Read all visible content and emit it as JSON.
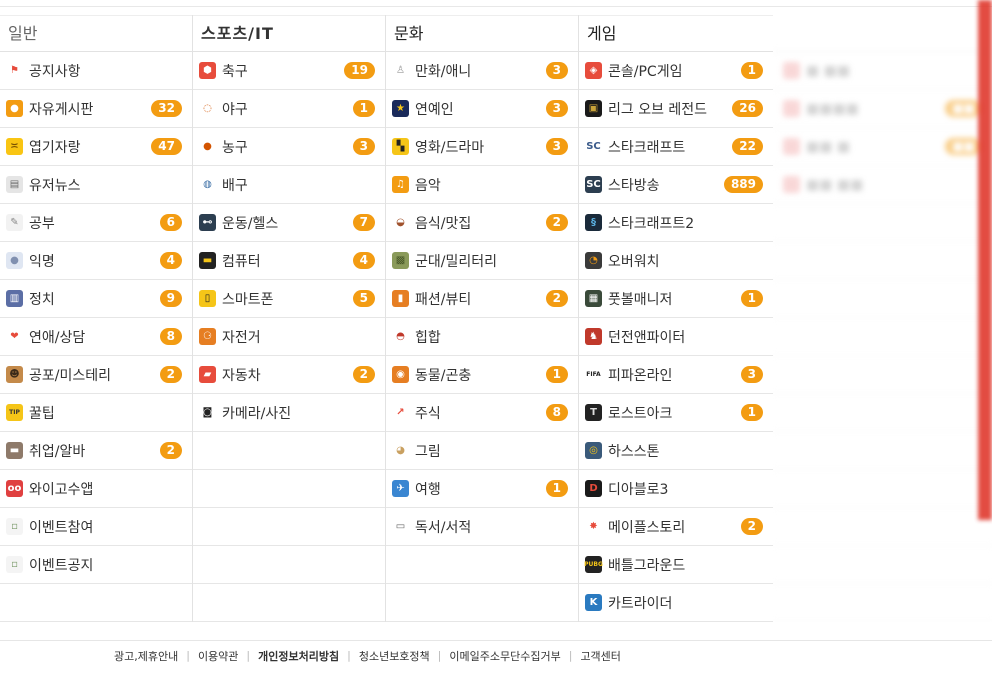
{
  "columns": [
    {
      "title": "일반",
      "items": [
        {
          "icon": "flag-icon",
          "glyph": "⚑",
          "color": "#e74c3c",
          "bg": "transparent",
          "label": "공지사항",
          "count": ""
        },
        {
          "icon": "chat-bubble-icon",
          "glyph": "●",
          "color": "#ffffff",
          "bg": "#f39c12",
          "label": "자유게시판",
          "count": "32"
        },
        {
          "icon": "laughing-face-icon",
          "glyph": "≍",
          "color": "#7a5200",
          "bg": "#f9c513",
          "label": "엽기자랑",
          "count": "47"
        },
        {
          "icon": "newspaper-icon",
          "glyph": "▤",
          "color": "#666",
          "bg": "#e5e5e5",
          "label": "유저뉴스",
          "count": ""
        },
        {
          "icon": "pencil-note-icon",
          "glyph": "✎",
          "color": "#888",
          "bg": "#f2f2f2",
          "label": "공부",
          "count": "6"
        },
        {
          "icon": "user-silhouette-icon",
          "glyph": "●",
          "color": "#8090b0",
          "bg": "#dfe6f2",
          "label": "익명",
          "count": "4"
        },
        {
          "icon": "government-building-icon",
          "glyph": "▥",
          "color": "#fff",
          "bg": "#5b6ea5",
          "label": "정치",
          "count": "9"
        },
        {
          "icon": "heart-icon",
          "glyph": "❤",
          "color": "#e74c3c",
          "bg": "transparent",
          "label": "연애/상담",
          "count": "8"
        },
        {
          "icon": "horror-face-icon",
          "glyph": "☻",
          "color": "#3a2a1a",
          "bg": "#c48a4a",
          "label": "공포/미스테리",
          "count": "2"
        },
        {
          "icon": "tip-badge-icon",
          "glyph": "TIP",
          "color": "#333",
          "bg": "#f5c518",
          "label": "꿀팁",
          "count": ""
        },
        {
          "icon": "briefcase-icon",
          "glyph": "▬",
          "color": "#fff",
          "bg": "#8e7a6a",
          "label": "취업/알바",
          "count": "2"
        },
        {
          "icon": "monster-icon",
          "glyph": "oo",
          "color": "#fff",
          "bg": "#e04040",
          "label": "와이고수앱",
          "count": ""
        },
        {
          "icon": "broken-image-icon",
          "glyph": "▫",
          "color": "#7a9a6a",
          "bg": "#f4f4f4",
          "label": "이벤트참여",
          "count": ""
        },
        {
          "icon": "broken-image-icon",
          "glyph": "▫",
          "color": "#7a9a6a",
          "bg": "#f4f4f4",
          "label": "이벤트공지",
          "count": ""
        },
        {
          "icon": "",
          "glyph": "",
          "color": "",
          "bg": "transparent",
          "label": "",
          "count": ""
        }
      ]
    },
    {
      "title": "스포츠/IT",
      "items": [
        {
          "icon": "soccer-ball-icon",
          "glyph": "⬢",
          "color": "#fff",
          "bg": "#e74c3c",
          "label": "축구",
          "count": "19"
        },
        {
          "icon": "baseball-icon",
          "glyph": "◌",
          "color": "#d35400",
          "bg": "#ffffff",
          "label": "야구",
          "count": "1"
        },
        {
          "icon": "basketball-icon",
          "glyph": "●",
          "color": "#d35400",
          "bg": "transparent",
          "label": "농구",
          "count": "3"
        },
        {
          "icon": "volleyball-icon",
          "glyph": "◍",
          "color": "#3a6ea5",
          "bg": "transparent",
          "label": "배구",
          "count": ""
        },
        {
          "icon": "dumbbell-icon",
          "glyph": "⊷",
          "color": "#fff",
          "bg": "#2c3e50",
          "label": "운동/헬스",
          "count": "7"
        },
        {
          "icon": "monitor-icon",
          "glyph": "▬",
          "color": "#f5c518",
          "bg": "#222",
          "label": "컴퓨터",
          "count": "4"
        },
        {
          "icon": "smartphone-icon",
          "glyph": "▯",
          "color": "#222",
          "bg": "#f5c518",
          "label": "스마트폰",
          "count": "5"
        },
        {
          "icon": "bicycle-icon",
          "glyph": "⚆",
          "color": "#fff",
          "bg": "#e67e22",
          "label": "자전거",
          "count": ""
        },
        {
          "icon": "car-icon",
          "glyph": "▰",
          "color": "#fff",
          "bg": "#e74c3c",
          "label": "자동차",
          "count": "2"
        },
        {
          "icon": "camera-icon",
          "glyph": "◙",
          "color": "#222",
          "bg": "transparent",
          "label": "카메라/사진",
          "count": ""
        },
        {
          "icon": "",
          "glyph": "",
          "color": "",
          "bg": "transparent",
          "label": "",
          "count": ""
        },
        {
          "icon": "",
          "glyph": "",
          "color": "",
          "bg": "transparent",
          "label": "",
          "count": ""
        },
        {
          "icon": "",
          "glyph": "",
          "color": "",
          "bg": "transparent",
          "label": "",
          "count": ""
        },
        {
          "icon": "",
          "glyph": "",
          "color": "",
          "bg": "transparent",
          "label": "",
          "count": ""
        },
        {
          "icon": "",
          "glyph": "",
          "color": "",
          "bg": "transparent",
          "label": "",
          "count": ""
        }
      ]
    },
    {
      "title": "문화",
      "items": [
        {
          "icon": "comic-character-icon",
          "glyph": "♙",
          "color": "#999",
          "bg": "transparent",
          "label": "만화/애니",
          "count": "3"
        },
        {
          "icon": "star-icon",
          "glyph": "★",
          "color": "#f5c518",
          "bg": "#1a2a5a",
          "label": "연예인",
          "count": "3"
        },
        {
          "icon": "clapperboard-icon",
          "glyph": "▚",
          "color": "#222",
          "bg": "#f5c518",
          "label": "영화/드라마",
          "count": "3"
        },
        {
          "icon": "music-note-icon",
          "glyph": "♫",
          "color": "#fff",
          "bg": "#f39c12",
          "label": "음악",
          "count": ""
        },
        {
          "icon": "hamburger-icon",
          "glyph": "◒",
          "color": "#a0522d",
          "bg": "transparent",
          "label": "음식/맛집",
          "count": "2"
        },
        {
          "icon": "camouflage-icon",
          "glyph": "▩",
          "color": "#4a5a2a",
          "bg": "#8a9a5a",
          "label": "군대/밀리터리",
          "count": ""
        },
        {
          "icon": "fashion-icon",
          "glyph": "▮",
          "color": "#fff",
          "bg": "#e67e22",
          "label": "패션/뷰티",
          "count": "2"
        },
        {
          "icon": "cap-icon",
          "glyph": "◓",
          "color": "#c0392b",
          "bg": "transparent",
          "label": "힙합",
          "count": ""
        },
        {
          "icon": "dog-face-icon",
          "glyph": "◉",
          "color": "#fff",
          "bg": "#e67e22",
          "label": "동물/곤충",
          "count": "1"
        },
        {
          "icon": "chart-trend-icon",
          "glyph": "↗",
          "color": "#e74c3c",
          "bg": "transparent",
          "label": "주식",
          "count": "8"
        },
        {
          "icon": "palette-icon",
          "glyph": "◕",
          "color": "#c9a060",
          "bg": "transparent",
          "label": "그림",
          "count": ""
        },
        {
          "icon": "airplane-icon",
          "glyph": "✈",
          "color": "#fff",
          "bg": "#3a86d1",
          "label": "여행",
          "count": "1"
        },
        {
          "icon": "open-book-icon",
          "glyph": "▭",
          "color": "#666",
          "bg": "transparent",
          "label": "독서/서적",
          "count": ""
        },
        {
          "icon": "",
          "glyph": "",
          "color": "",
          "bg": "transparent",
          "label": "",
          "count": ""
        },
        {
          "icon": "",
          "glyph": "",
          "color": "",
          "bg": "transparent",
          "label": "",
          "count": ""
        }
      ]
    },
    {
      "title": "게임",
      "items": [
        {
          "icon": "gamepad-icon",
          "glyph": "◈",
          "color": "#fff",
          "bg": "#e74c3c",
          "label": "콘솔/PC게임",
          "count": "1"
        },
        {
          "icon": "lol-logo-icon",
          "glyph": "▣",
          "color": "#c9a33a",
          "bg": "#1a1a1a",
          "label": "리그 오브 레전드",
          "count": "26"
        },
        {
          "icon": "starcraft-logo-icon",
          "glyph": "SC",
          "color": "#3a5a8a",
          "bg": "transparent",
          "label": "스타크래프트",
          "count": "22"
        },
        {
          "icon": "starcraft-broadcast-icon",
          "glyph": "SC",
          "color": "#fff",
          "bg": "#2c3e50",
          "label": "스타방송",
          "count": "889"
        },
        {
          "icon": "starcraft2-logo-icon",
          "glyph": "§",
          "color": "#5ab0e0",
          "bg": "#1a2a3a",
          "label": "스타크래프트2",
          "count": ""
        },
        {
          "icon": "overwatch-logo-icon",
          "glyph": "◔",
          "color": "#f39c12",
          "bg": "#3a3a3a",
          "label": "오버워치",
          "count": ""
        },
        {
          "icon": "football-manager-icon",
          "glyph": "▦",
          "color": "#fff",
          "bg": "#3a4a3a",
          "label": "풋볼매니저",
          "count": "1"
        },
        {
          "icon": "dungeon-fighter-icon",
          "glyph": "♞",
          "color": "#fff",
          "bg": "#c0392b",
          "label": "던전앤파이터",
          "count": ""
        },
        {
          "icon": "fifa-online-icon",
          "glyph": "FIFA",
          "color": "#222",
          "bg": "transparent",
          "label": "피파온라인",
          "count": "3"
        },
        {
          "icon": "lost-ark-icon",
          "glyph": "T",
          "color": "#ddd",
          "bg": "#222",
          "label": "로스트아크",
          "count": "1"
        },
        {
          "icon": "hearthstone-icon",
          "glyph": "◎",
          "color": "#f5c518",
          "bg": "#3a5a7a",
          "label": "하스스톤",
          "count": ""
        },
        {
          "icon": "diablo3-icon",
          "glyph": "D",
          "color": "#e74c3c",
          "bg": "#1a1a1a",
          "label": "디아블로3",
          "count": ""
        },
        {
          "icon": "maple-leaf-icon",
          "glyph": "✸",
          "color": "#e74c3c",
          "bg": "transparent",
          "label": "메이플스토리",
          "count": "2"
        },
        {
          "icon": "battlegrounds-icon",
          "glyph": "PUBG",
          "color": "#f5c518",
          "bg": "#222",
          "label": "배틀그라운드",
          "count": ""
        },
        {
          "icon": "kartrider-icon",
          "glyph": "K",
          "color": "#fff",
          "bg": "#2a7ac0",
          "label": "카트라이더",
          "count": ""
        }
      ]
    }
  ],
  "footer": {
    "links": [
      "광고,제휴안내",
      "이용약관",
      "개인정보처리방침",
      "청소년보호정책",
      "이메일주소무단수집거부",
      "고객센터"
    ],
    "bold_index": 2
  },
  "blur_column": {
    "items": [
      {
        "label": "■ ■■",
        "count": ""
      },
      {
        "label": "■■■■",
        "count": "■■"
      },
      {
        "label": "■■ ■",
        "count": "■■"
      },
      {
        "label": "■■ ■■",
        "count": ""
      }
    ]
  }
}
